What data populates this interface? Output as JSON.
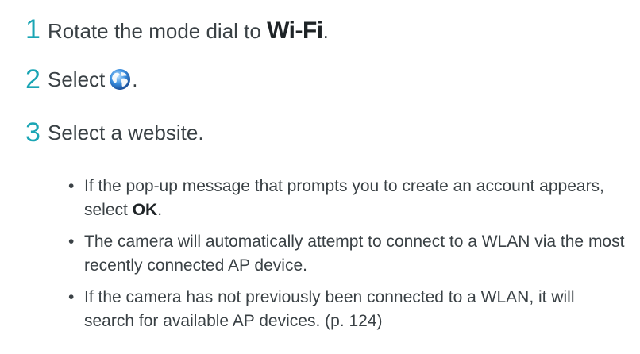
{
  "steps": [
    {
      "number": "1",
      "text": "Rotate the mode dial to",
      "mode_mark": "Wi-Fi",
      "suffix": "."
    },
    {
      "number": "2",
      "text": "Select",
      "icon": "globe-icon",
      "suffix": "."
    },
    {
      "number": "3",
      "text": "Select a website."
    }
  ],
  "bullets": [
    {
      "text_before": "If the pop-up message that prompts you to create an account appears, select ",
      "bold": "OK",
      "text_after": "."
    },
    {
      "text": "The camera will automatically attempt to connect to a WLAN via the most recently connected AP device."
    },
    {
      "text": "If the camera has not previously been connected to a WLAN, it will search for available AP devices. (p. 124)"
    }
  ],
  "colors": {
    "step_number": "#1aa5b4",
    "body_text": "#3a4145"
  }
}
